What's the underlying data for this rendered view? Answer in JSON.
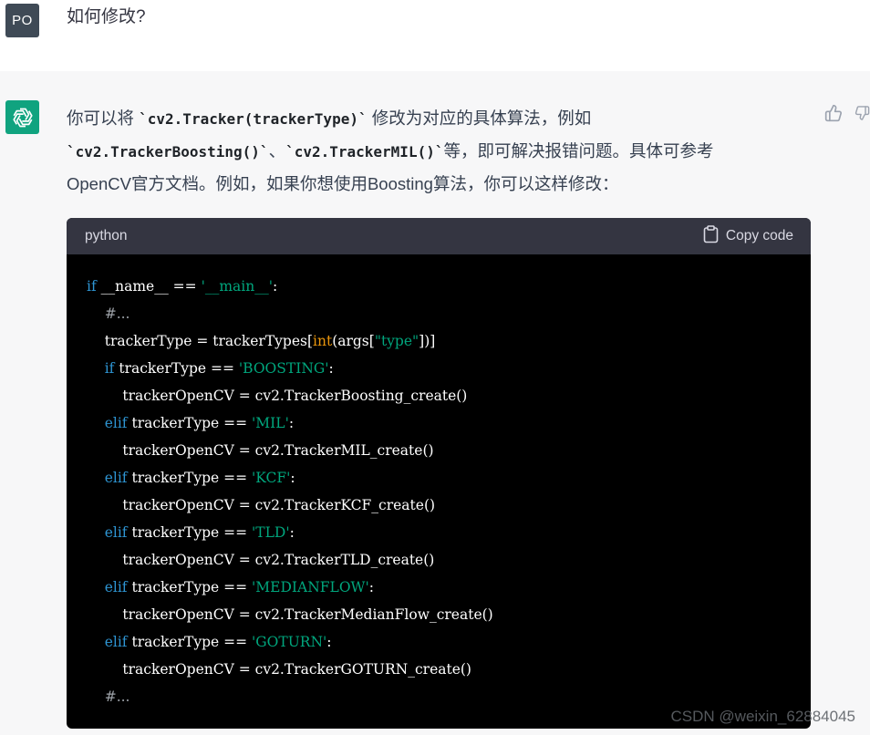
{
  "user": {
    "avatar_initials": "PO",
    "message": "如何修改?"
  },
  "assistant": {
    "intro_1": "你可以将 ",
    "code_1": "`cv2.Tracker(trackerType)`",
    "intro_2": " 修改为对应的具体算法，例如",
    "code_2": "`cv2.TrackerBoosting()`",
    "intro_3": "、",
    "code_3": "`cv2.TrackerMIL()`",
    "intro_4": "等，即可解决报错问题。具体可参考",
    "intro_5": "OpenCV官方文档。例如，如果你想使用Boosting算法，你可以这样修改："
  },
  "code_block": {
    "language": "python",
    "copy_label": "Copy code",
    "lines": [
      {
        "indent": "",
        "parts": [
          [
            "kw",
            "if"
          ],
          [
            "t",
            " __name__ == "
          ],
          [
            "str",
            "'__main__'"
          ],
          [
            "t",
            ":"
          ]
        ]
      },
      {
        "indent": "    ",
        "parts": [
          [
            "cm",
            "#..."
          ]
        ]
      },
      {
        "indent": "    ",
        "parts": [
          [
            "t",
            "trackerType = trackerTypes["
          ],
          [
            "bi",
            "int"
          ],
          [
            "t",
            "(args["
          ],
          [
            "str",
            "\"type\""
          ],
          [
            "t",
            "])]"
          ]
        ]
      },
      {
        "indent": "    ",
        "parts": [
          [
            "kw",
            "if"
          ],
          [
            "t",
            " trackerType == "
          ],
          [
            "str",
            "'BOOSTING'"
          ],
          [
            "t",
            ":"
          ]
        ]
      },
      {
        "indent": "        ",
        "parts": [
          [
            "t",
            "trackerOpenCV = cv2.TrackerBoosting_create()"
          ]
        ]
      },
      {
        "indent": "    ",
        "parts": [
          [
            "kw",
            "elif"
          ],
          [
            "t",
            " trackerType == "
          ],
          [
            "str",
            "'MIL'"
          ],
          [
            "t",
            ":"
          ]
        ]
      },
      {
        "indent": "        ",
        "parts": [
          [
            "t",
            "trackerOpenCV = cv2.TrackerMIL_create()"
          ]
        ]
      },
      {
        "indent": "    ",
        "parts": [
          [
            "kw",
            "elif"
          ],
          [
            "t",
            " trackerType == "
          ],
          [
            "str",
            "'KCF'"
          ],
          [
            "t",
            ":"
          ]
        ]
      },
      {
        "indent": "        ",
        "parts": [
          [
            "t",
            "trackerOpenCV = cv2.TrackerKCF_create()"
          ]
        ]
      },
      {
        "indent": "    ",
        "parts": [
          [
            "kw",
            "elif"
          ],
          [
            "t",
            " trackerType == "
          ],
          [
            "str",
            "'TLD'"
          ],
          [
            "t",
            ":"
          ]
        ]
      },
      {
        "indent": "        ",
        "parts": [
          [
            "t",
            "trackerOpenCV = cv2.TrackerTLD_create()"
          ]
        ]
      },
      {
        "indent": "    ",
        "parts": [
          [
            "kw",
            "elif"
          ],
          [
            "t",
            " trackerType == "
          ],
          [
            "str",
            "'MEDIANFLOW'"
          ],
          [
            "t",
            ":"
          ]
        ]
      },
      {
        "indent": "        ",
        "parts": [
          [
            "t",
            "trackerOpenCV = cv2.TrackerMedianFlow_create()"
          ]
        ]
      },
      {
        "indent": "    ",
        "parts": [
          [
            "kw",
            "elif"
          ],
          [
            "t",
            " trackerType == "
          ],
          [
            "str",
            "'GOTURN'"
          ],
          [
            "t",
            ":"
          ]
        ]
      },
      {
        "indent": "        ",
        "parts": [
          [
            "t",
            "trackerOpenCV = cv2.TrackerGOTURN_create()"
          ]
        ]
      },
      {
        "indent": "    ",
        "parts": [
          [
            "cm",
            "#..."
          ]
        ]
      }
    ]
  },
  "watermark": "CSDN @weixin_62884045",
  "icons": {
    "assistant_logo": "openai-logo-icon",
    "thumbs_up": "thumbs-up-icon",
    "thumbs_down": "thumbs-down-icon",
    "clipboard": "clipboard-icon"
  },
  "colors": {
    "assistant_avatar": "#10a37f",
    "user_avatar": "#3f4a56",
    "code_header": "#343541",
    "keyword": "#2e95d3",
    "string": "#00a67d",
    "builtin": "#e9950c"
  }
}
